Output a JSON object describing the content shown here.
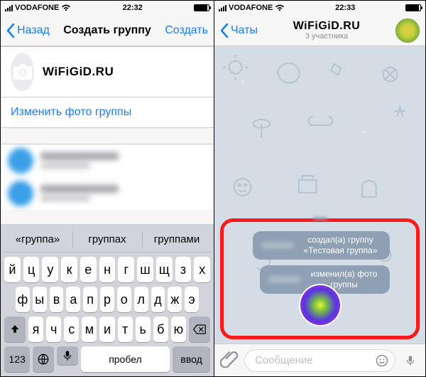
{
  "left": {
    "status": {
      "carrier": "VODAFONE",
      "time": "22:32"
    },
    "nav": {
      "back": "Назад",
      "title": "Создать группу",
      "create": "Создать"
    },
    "group_name": "WiFiGiD.RU",
    "change_photo_label": "Изменить фото группы",
    "keyboard": {
      "suggestions": [
        "«группа»",
        "группах",
        "группами"
      ],
      "row1": [
        "й",
        "ц",
        "у",
        "к",
        "е",
        "н",
        "г",
        "ш",
        "щ",
        "з",
        "х"
      ],
      "row2": [
        "ф",
        "ы",
        "в",
        "а",
        "п",
        "р",
        "о",
        "л",
        "д",
        "ж",
        "э"
      ],
      "row3": [
        "я",
        "ч",
        "с",
        "м",
        "и",
        "т",
        "ь",
        "б",
        "ю"
      ],
      "num_key": "123",
      "space": "Пробел",
      "return": "Ввод"
    }
  },
  "right": {
    "status": {
      "carrier": "VODAFONE",
      "time": "22:33"
    },
    "nav": {
      "back": "Чаты",
      "title": "WiFiGiD.RU",
      "subtitle": "3 участника"
    },
    "service_msg_1": "создал(а) группу «Тестовая группа»",
    "service_msg_2": "изменил(а) фото группы",
    "input_placeholder": "Сообщение"
  }
}
